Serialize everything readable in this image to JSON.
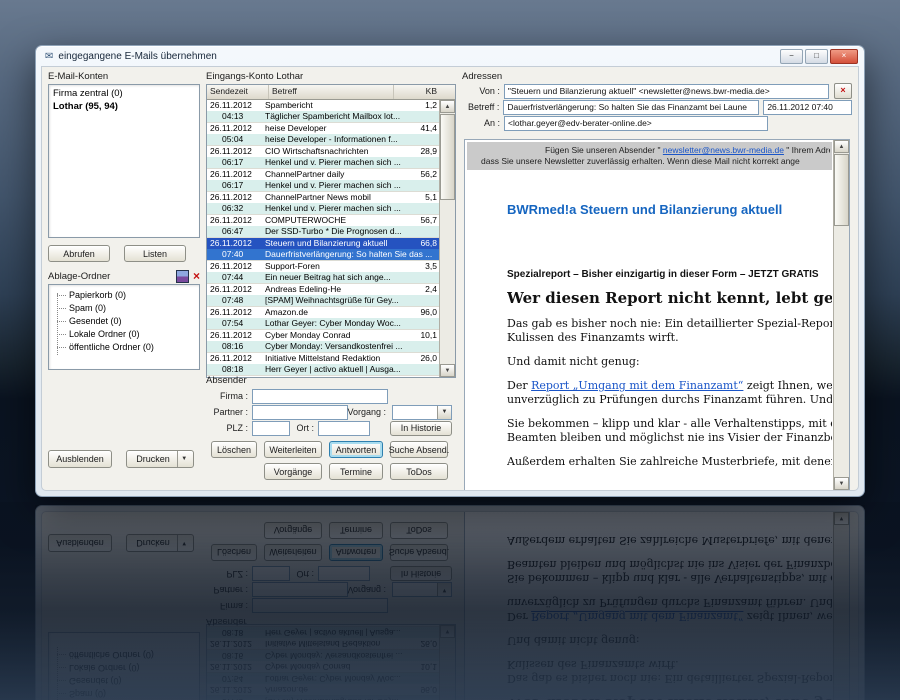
{
  "window": {
    "title": "eingegangene E-Mails übernehmen",
    "icon": "✉",
    "controls": {
      "minimize": "−",
      "maximize": "□",
      "close": "×"
    }
  },
  "scroll": {
    "up": "▲",
    "down": "▼"
  },
  "left": {
    "accounts_label": "E-Mail-Konten",
    "accounts": [
      {
        "label": "Firma zentral (0)"
      },
      {
        "label": "Lothar (95, 94)",
        "bold": true
      }
    ],
    "abrufen": "Abrufen",
    "listen": "Listen",
    "folders_label": "Ablage-Ordner",
    "folders_close": "×",
    "folders": [
      {
        "label": "Papierkorb (0)"
      },
      {
        "label": "Spam (0)"
      },
      {
        "label": "Gesendet (0)"
      },
      {
        "label": "Lokale Ordner (0)"
      },
      {
        "label": "öffentliche Ordner (0)"
      }
    ],
    "ausblenden": "Ausblenden",
    "drucken": "Drucken",
    "drucken_arrow": "▼"
  },
  "list": {
    "title": "Eingangs-Konto Lothar",
    "col_sendezeit": "Sendezeit",
    "col_betreff": "Betreff",
    "col_kb": "KB",
    "rows": [
      {
        "date": "26.11.2012",
        "time": "04:13",
        "sender": "Spambericht",
        "subject": "Täglicher Spambericht Mailbox lot...",
        "kb": "1,2"
      },
      {
        "date": "26.11.2012",
        "time": "05:04",
        "sender": "heise Developer",
        "subject": "heise Developer - Informationen f...",
        "kb": "41,4"
      },
      {
        "date": "26.11.2012",
        "time": "06:17",
        "sender": "CIO Wirtschaftsnachrichten",
        "subject": "Henkel und v. Pierer machen sich ...",
        "kb": "28,9"
      },
      {
        "date": "26.11.2012",
        "time": "06:17",
        "sender": "ChannelPartner daily",
        "subject": "Henkel und v. Pierer machen sich ...",
        "kb": "56,2"
      },
      {
        "date": "26.11.2012",
        "time": "06:32",
        "sender": "ChannelPartner News mobil",
        "subject": "Henkel und v. Pierer machen sich ...",
        "kb": "5,1"
      },
      {
        "date": "26.11.2012",
        "time": "06:47",
        "sender": "COMPUTERWOCHE",
        "subject": "Der SSD-Turbo * Die Prognosen d...",
        "kb": "56,7"
      },
      {
        "date": "26.11.2012",
        "time": "07:40",
        "sender": "Steuern und Bilanzierung aktuell",
        "subject": "Dauerfristverlängerung: So halten Sie das ...",
        "kb": "66,8",
        "selected": true
      },
      {
        "date": "26.11.2012",
        "time": "07:44",
        "sender": "Support-Foren",
        "subject": "Ein neuer Beitrag hat sich ange...",
        "kb": "3,5"
      },
      {
        "date": "26.11.2012",
        "time": "07:48",
        "sender": "Andreas Edeling-He",
        "subject": "[SPAM] Weihnachtsgrüße für Gey...",
        "kb": "2,4"
      },
      {
        "date": "26.11.2012",
        "time": "07:54",
        "sender": "Amazon.de",
        "subject": "Lothar Geyer: Cyber Monday Woc...",
        "kb": "96,0"
      },
      {
        "date": "26.11.2012",
        "time": "08:16",
        "sender": "Cyber Monday Conrad",
        "subject": "Cyber Monday: Versandkostenfrei ...",
        "kb": "10,1"
      },
      {
        "date": "26.11.2012",
        "time": "08:18",
        "sender": "Initiative Mittelstand Redaktion",
        "subject": "Herr Geyer | activo aktuell | Ausga...",
        "kb": "26,0"
      }
    ]
  },
  "absender": {
    "label": "Absender",
    "firma_label": "Firma :",
    "partner_label": "Partner :",
    "plz_label": "PLZ :",
    "ort_label": "Ort :",
    "vorgang_label": "Vorgang :",
    "combo_arrow": "▼",
    "in_historie": "In Historie"
  },
  "actions": {
    "loeschen": "Löschen",
    "weiterleiten": "Weiterleiten",
    "antworten": "Antworten",
    "suche_absender": "Suche Absend.",
    "vorgaenge": "Vorgänge",
    "termine": "Termine",
    "todos": "ToDos"
  },
  "adressen": {
    "label": "Adressen",
    "von_label": "Von :",
    "von_value": "\"Steuern und Bilanzierung aktuell\" <newsletter@news.bwr-media.de>",
    "address_action": "×",
    "betreff_label": "Betreff :",
    "betreff_value": "Dauerfristverlängerung: So halten Sie das Finanzamt bei Laune",
    "datum_value": "26.11.2012 07:40",
    "an_label": "An :",
    "an_value": "<lothar.geyer@edv-berater-online.de>"
  },
  "preview": {
    "banner_pre": "Fügen Sie unseren Absender \" ",
    "banner_link": "newsletter@news.bwr-media.de",
    "banner_post": " \" Ihrem Adressb",
    "banner_line2": "dass Sie unsere Newsletter zuverlässig erhalten. Wenn diese Mail nicht korrekt ange",
    "brand": "BWRmed!a",
    "brand_title": " Steuern und Bilanzierung aktuell",
    "subtitle": "Spezialreport – Bisher einzigartig in dieser Form – JETZT GRATIS",
    "headline": "Wer diesen Report nicht kennt, lebt gefährlich (und risk",
    "p1": "Das gab es bisher noch nie: Ein detaillierter Spezial-Report, der einen Bli\nKulissen des Finanzamts wirft.",
    "p2": "Und damit nicht genug:",
    "p3_pre": "Der ",
    "p3_link": "Report „Umgang mit dem Finanzamt“",
    "p3_post": " zeigt Ihnen, welche Fehler imm\nunverzüglich zu Prüfungen durchs Finanzamt führen. Und damit zu teure",
    "p4": "Sie bekommen – klipp und klar - alle Verhaltenstipps, mit denen Sie unau\nBeamten bleiben und möglichst nie ins Visier der Finanzbeamten",
    "p5": "Außerdem erhalten Sie zahlreiche Musterbriefe, mit denen Sie ab sofort"
  },
  "colors": {
    "selection": "#2553c0",
    "accent_blue": "#1565c0",
    "row_stripe": "#d9efec"
  }
}
